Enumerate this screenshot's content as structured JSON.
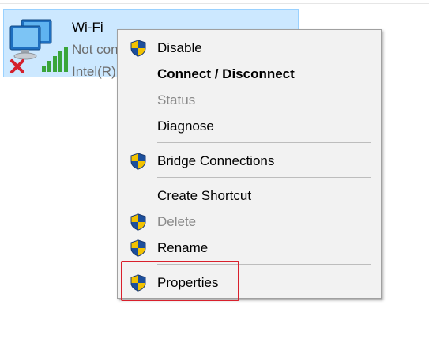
{
  "adapter": {
    "name": "Wi-Fi",
    "status": "Not con",
    "device": "Intel(R)",
    "icon": "wifi-adapter-disconnected-icon"
  },
  "context_menu": {
    "items": [
      {
        "label": "Disable",
        "shield": true,
        "style": "normal"
      },
      {
        "label": "Connect / Disconnect",
        "shield": false,
        "style": "bold"
      },
      {
        "label": "Status",
        "shield": false,
        "style": "disabled"
      },
      {
        "label": "Diagnose",
        "shield": false,
        "style": "normal"
      },
      {
        "label": "Bridge Connections",
        "shield": true,
        "style": "normal"
      },
      {
        "label": "Create Shortcut",
        "shield": false,
        "style": "normal"
      },
      {
        "label": "Delete",
        "shield": true,
        "style": "disabled"
      },
      {
        "label": "Rename",
        "shield": true,
        "style": "normal"
      },
      {
        "label": "Properties",
        "shield": true,
        "style": "normal"
      }
    ],
    "icon": "uac-shield-icon"
  },
  "highlight": {
    "target": "Properties",
    "color": "#d9202c"
  },
  "colors": {
    "selection_bg": "#cce8ff",
    "menu_bg": "#f2f2f2",
    "disabled_text": "#8a8a8a"
  }
}
